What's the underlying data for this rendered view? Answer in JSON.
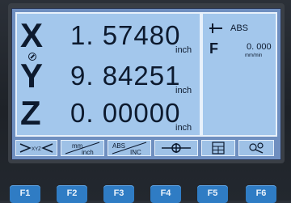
{
  "axes": [
    {
      "label": "X",
      "value": "1. 57480",
      "unit": "inch"
    },
    {
      "label": "Y",
      "value": "9. 84251",
      "unit": "inch"
    },
    {
      "label": "Z",
      "value": "0. 00000",
      "unit": "inch"
    }
  ],
  "right_panel": {
    "mode": "ABS",
    "feed_label": "F",
    "feed_value": "0. 000",
    "feed_unit": "mm/min"
  },
  "softkeys": {
    "xyz": "XYZ",
    "unit_top": "mm",
    "unit_bottom": "inch",
    "abs_label": "ABS",
    "inc_label": "INC"
  },
  "function_keys": [
    "F1",
    "F2",
    "F3",
    "F4",
    "F5",
    "F6"
  ],
  "colors": {
    "lcd": "#a3c7ec",
    "screen_bezel": "#6f8fc0",
    "text": "#0d1a2e",
    "function_key": "#2f7cc4"
  },
  "icons": {
    "axis_symbol": "diameter-icon",
    "mode_symbol": "origin-cross-icon",
    "softkey_center": "centering-icon",
    "softkey_calc": "calculator-icon",
    "softkey_tools": "tools-icon"
  }
}
